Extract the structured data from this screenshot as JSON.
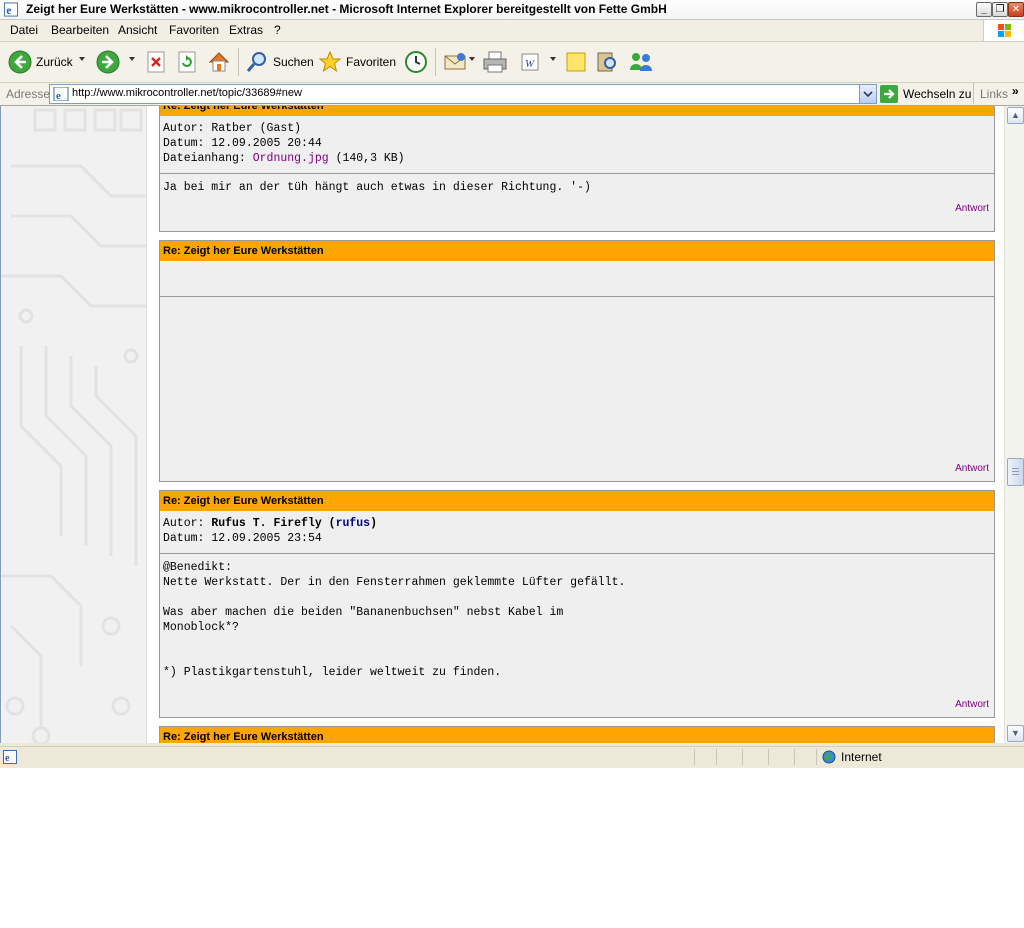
{
  "window": {
    "title": "Zeigt her Eure Werkstätten - www.mikrocontroller.net - Microsoft Internet Explorer bereitgestellt von Fette GmbH"
  },
  "menu": [
    "Datei",
    "Bearbeiten",
    "Ansicht",
    "Favoriten",
    "Extras",
    "?"
  ],
  "toolbar": {
    "back": "Zurück",
    "search": "Suchen",
    "favorites": "Favoriten"
  },
  "address": {
    "label": "Adresse",
    "url": "http://www.mikrocontroller.net/topic/33689#new",
    "go": "Wechseln zu",
    "links": "Links"
  },
  "posts": [
    {
      "subject": "Re: Zeigt her Eure Werkstätten",
      "author_label": "Autor:",
      "author": "Ratber (Gast)",
      "date_label": "Datum:",
      "date": "12.09.2005 20:44",
      "attachment_label": "Dateianhang:",
      "attachment_name": "Ordnung.jpg",
      "attachment_size": "(140,3 KB)",
      "body": "Ja bei mir an der tüh hängt auch etwas in dieser Richtung. '-)",
      "reply": "Antwort"
    },
    {
      "subject": "Re: Zeigt her Eure Werkstätten",
      "body": "",
      "reply": "Antwort"
    },
    {
      "subject": "Re: Zeigt her Eure Werkstätten",
      "author_label": "Autor:",
      "author": "Rufus T. Firefly",
      "author_user": "rufus",
      "date_label": "Datum:",
      "date": "12.09.2005 23:54",
      "body": "@Benedikt:\nNette Werkstatt. Der in den Fensterrahmen geklemmte Lüfter gefällt.\n\nWas aber machen die beiden \"Bananenbuchsen\" nebst Kabel im\nMonoblock*?\n\n\n*) Plastikgartenstuhl, leider weltweit zu finden.",
      "reply": "Antwort"
    },
    {
      "subject": "Re: Zeigt her Eure Werkstätten"
    }
  ],
  "status": {
    "zone": "Internet"
  },
  "colors": {
    "post_header": "#ffa500",
    "post_background": "#efefef",
    "visited_link": "#800080",
    "user_link": "#000080"
  }
}
